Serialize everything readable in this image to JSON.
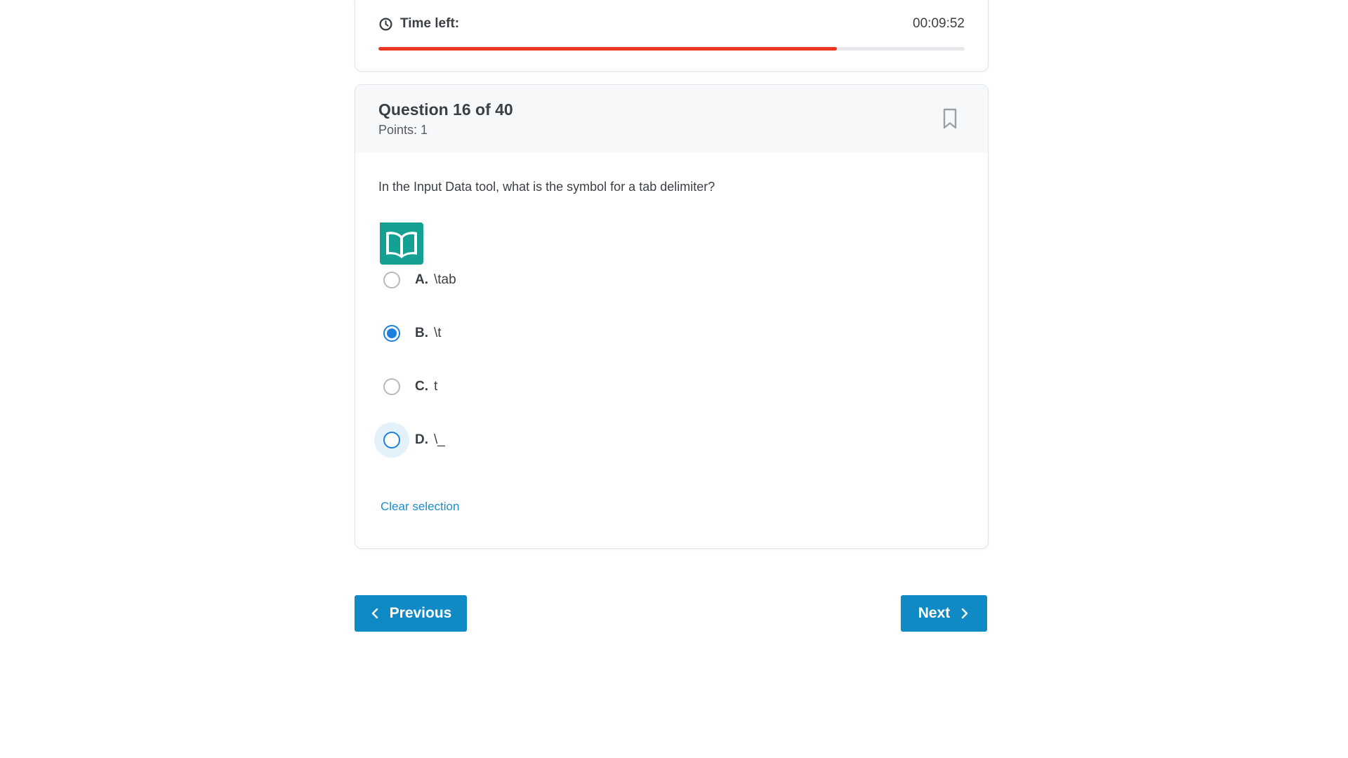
{
  "timer": {
    "label": "Time left:",
    "value": "00:09:52",
    "progress_fraction": 0.782,
    "progress_color": "#e8361f",
    "icon": "clock-icon"
  },
  "question": {
    "title": "Question 16 of 40",
    "points": "Points: 1",
    "text": "In the Input Data tool, what is the symbol for a tab delimiter?",
    "image_icon": "book-icon",
    "bookmark_icon": "bookmark-icon",
    "options": [
      {
        "letter": "A.",
        "text": "\\tab",
        "selected": false
      },
      {
        "letter": "B.",
        "text": "\\t",
        "selected": true
      },
      {
        "letter": "C.",
        "text": "t",
        "selected": false
      },
      {
        "letter": "D.",
        "text": "\\_",
        "selected": false
      }
    ],
    "clear_label": "Clear selection"
  },
  "nav": {
    "previous_label": "Previous",
    "next_label": "Next"
  },
  "colors": {
    "accent": "#0f8ac4",
    "radio_selected": "#1d7fe0",
    "book_icon": "#15a094"
  }
}
